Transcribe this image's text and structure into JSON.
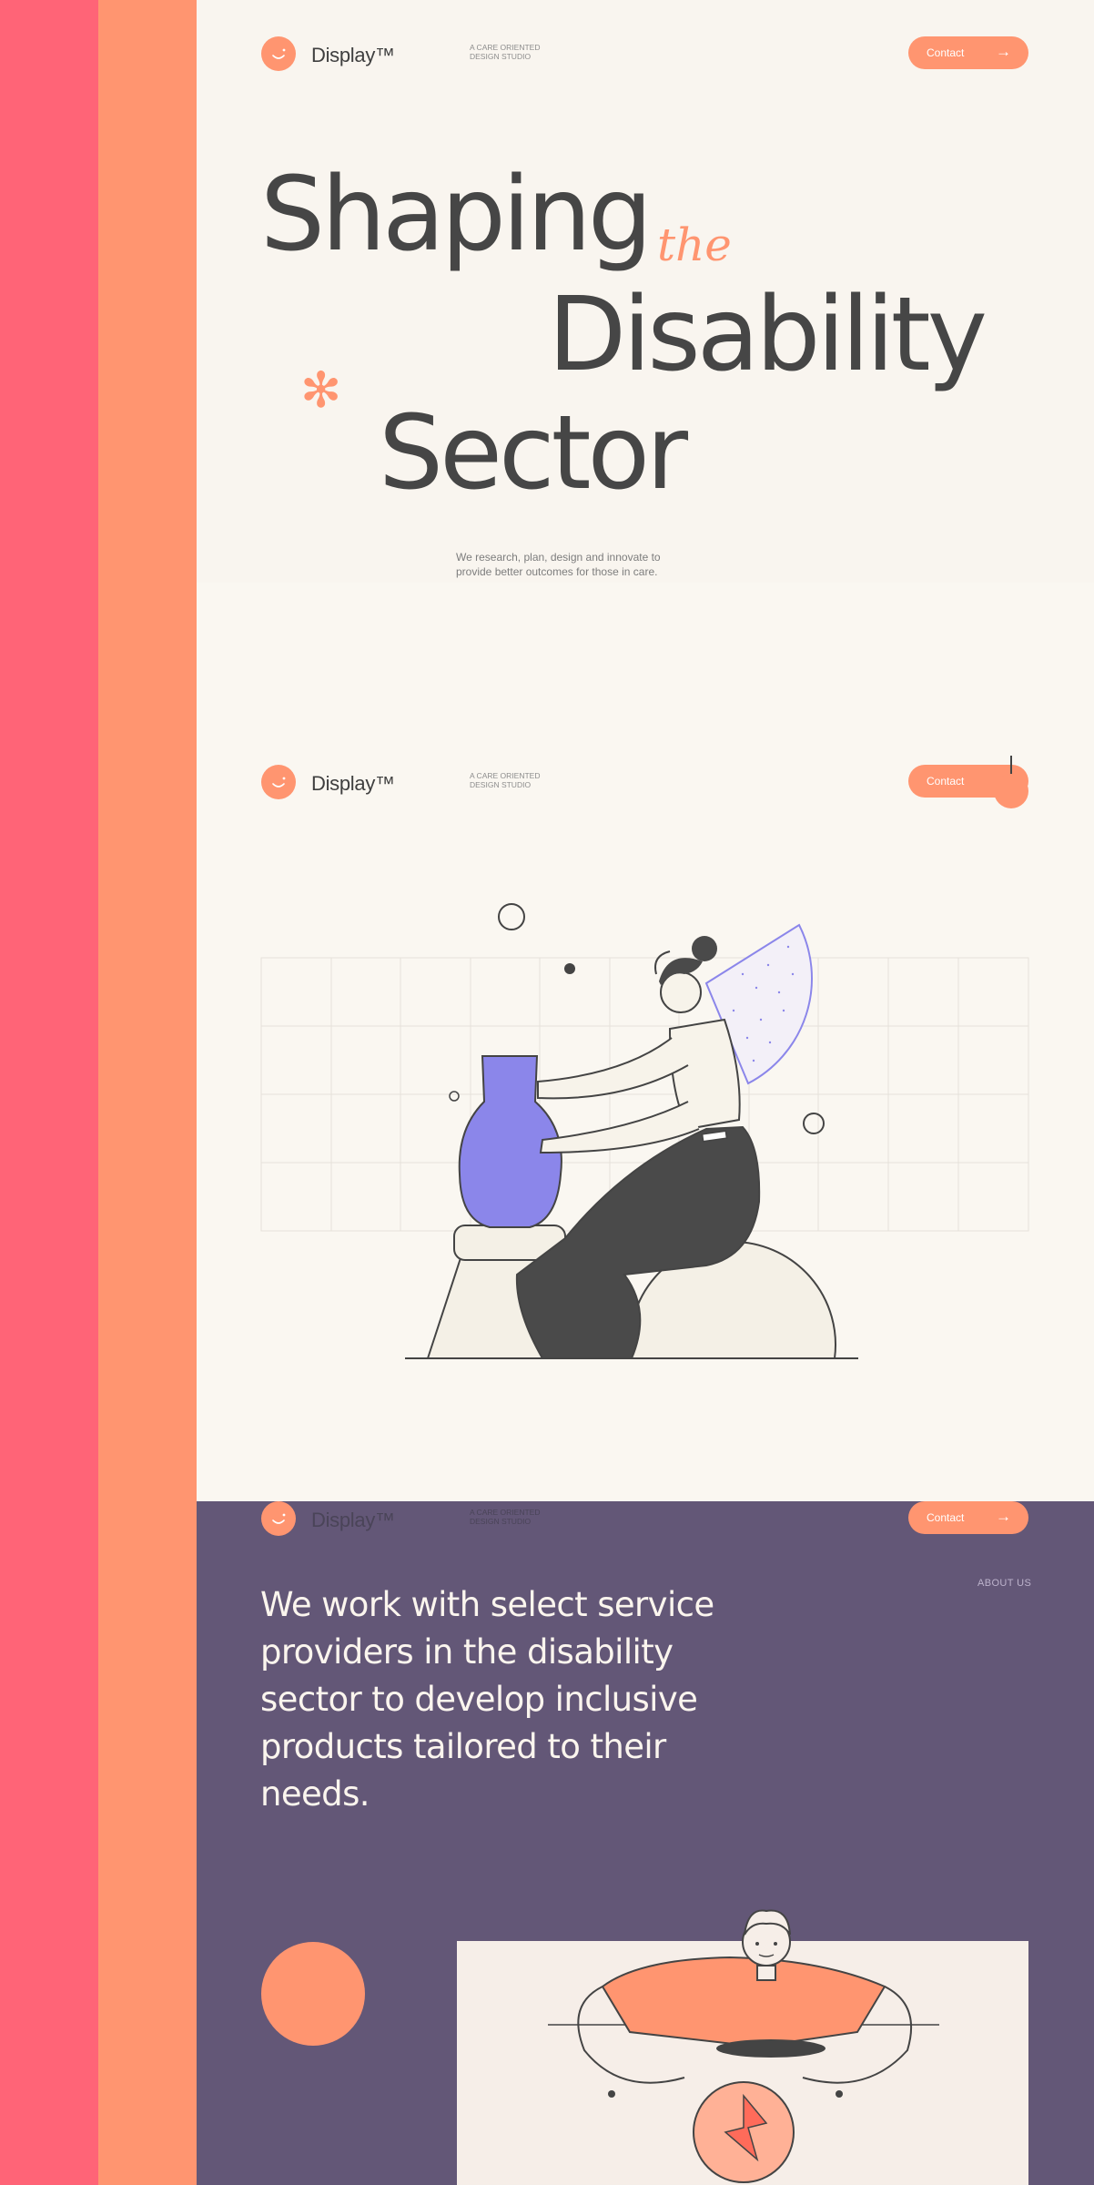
{
  "brand": {
    "name": "Display™",
    "tagline": "A CARE ORIENTED DESIGN STUDIO"
  },
  "nav": {
    "contact_label": "Contact",
    "contact_icon": "arrow-right-icon"
  },
  "hero": {
    "line1": "Shaping",
    "accent": "the",
    "line2": "Disability",
    "line3": "Sector",
    "subtitle": "We research, plan, design and innovate to provide better outcomes for those in care."
  },
  "about": {
    "label": "ABOUT US",
    "text": "We work with select service providers in the disability sector to develop inclusive products tailored to their needs."
  },
  "colors": {
    "stripe_red": "#ff6477",
    "stripe_orange": "#ff9570",
    "cream": "#f9f5ef",
    "purple": "#635777",
    "vase": "#8b86ea",
    "dark": "#464646"
  }
}
